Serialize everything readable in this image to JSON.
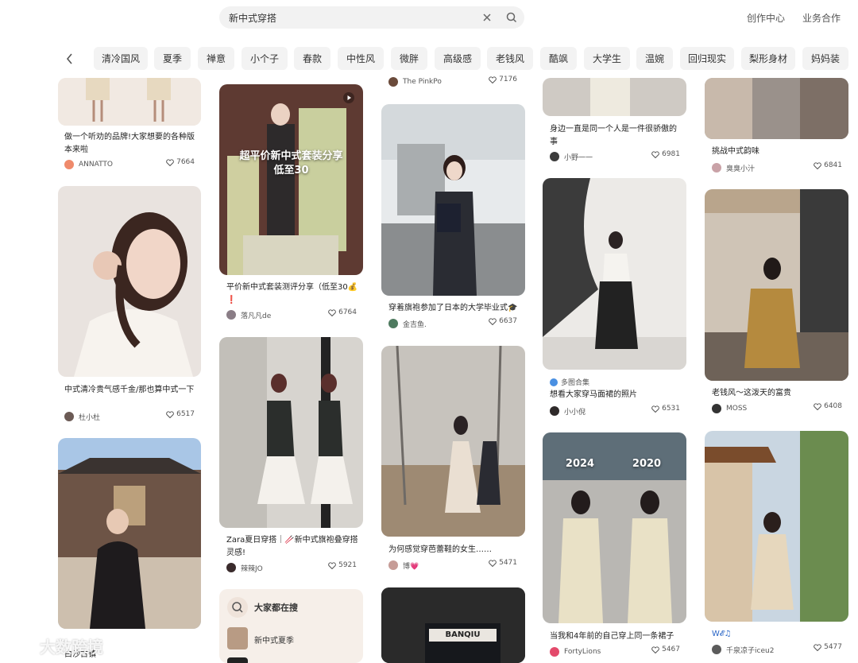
{
  "search": {
    "value": "新中式穿搭"
  },
  "header": {
    "creator_label": "创作中心",
    "business_label": "业务合作"
  },
  "chips": [
    "清冷国风",
    "夏季",
    "禅意",
    "小个子",
    "春款",
    "中性风",
    "微胖",
    "高级感",
    "老钱风",
    "酷飒",
    "大学生",
    "温婉",
    "回归现实",
    "梨形身材",
    "妈妈装"
  ],
  "cards": {
    "c1": {
      "title": "做一个听劝的品牌!大家想要的各种版本来啦",
      "author": "ANNATTO",
      "likes": "7664"
    },
    "c2": {
      "title": "中式清冷贵气感千金/那也算中式一下",
      "author": "杜小杜",
      "likes": "6517"
    },
    "c4": {
      "overlay": "超平价新中式套装分享\n低至30",
      "title": "平价新中式套装测评分享（低至30💰❗",
      "author": "落凡凡de",
      "likes": "6764"
    },
    "c5": {
      "title": "Zara夏日穿搭｜🥢新中式旗袍叠穿搭灵感!",
      "author": "辣辣JO",
      "likes": "5921"
    },
    "c7": {
      "author": "The PinkPo",
      "likes": "7176"
    },
    "c8": {
      "title": "穿着旗袍参加了日本的大学毕业式🎓",
      "author": "金吉鱼.",
      "likes": "6637"
    },
    "c9": {
      "title": "为何感觉穿芭蕾鞋的女生……",
      "author": "博💗",
      "likes": "5471"
    },
    "c10": {
      "overlay": "BANQIU"
    },
    "c11": {
      "title": "身边一直是同一个人是一件很骄傲的事",
      "author": "小野一一",
      "likes": "6981"
    },
    "c12": {
      "tag": "多图合集",
      "title": "想看大家穿马面裙的照片",
      "author": "小小倪",
      "likes": "6531"
    },
    "c13": {
      "overlay_left": "2024",
      "overlay_right": "2020",
      "title": "当我和4年前的自己穿上同一条裙子",
      "author": "FortyLions",
      "likes": "5467"
    },
    "c14": {
      "title": "挑战中式韵味",
      "author": "臭臭小汁",
      "likes": "6841"
    },
    "c15": {
      "title": "老钱风～这泼天的富贵",
      "author": "MOSS",
      "likes": "6408"
    },
    "c16": {
      "title": "W𝓔♫",
      "author": "千泉凉子iceu2",
      "likes": "5477"
    }
  },
  "search_card": {
    "title": "大家都在搜",
    "item1": "新中式夏季"
  },
  "partial_title": "白沙古镇",
  "watermark": "大数跨境"
}
